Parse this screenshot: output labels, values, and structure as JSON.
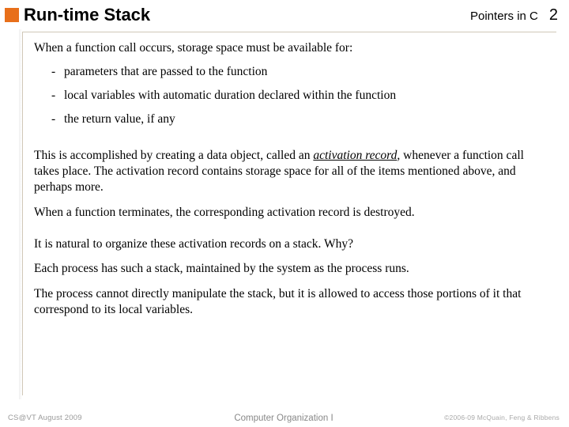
{
  "header": {
    "title": "Run-time Stack",
    "subject": "Pointers in C",
    "page": "2"
  },
  "body": {
    "intro": "When a function call occurs, storage space must be available for:",
    "bullets": [
      "parameters that are passed to the function",
      "local variables with automatic duration declared within the function",
      "the return value, if any"
    ],
    "p1a": "This is accomplished by creating a data object, called an ",
    "p1_emph": "activation record",
    "p1b": ", whenever a function call takes place.  The activation record contains storage space for all of the items mentioned above, and perhaps more.",
    "p2": "When a function terminates, the corresponding activation record is destroyed.",
    "p3": "It is natural to organize these activation records on a stack.  Why?",
    "p4": "Each process has such a stack, maintained by the system as the process runs.",
    "p5": "The process cannot directly manipulate the stack, but it is allowed to access those portions of it that correspond to its local variables."
  },
  "footer": {
    "left": "CS@VT August 2009",
    "center": "Computer Organization I",
    "right": "©2006-09  McQuain, Feng & Ribbens"
  }
}
